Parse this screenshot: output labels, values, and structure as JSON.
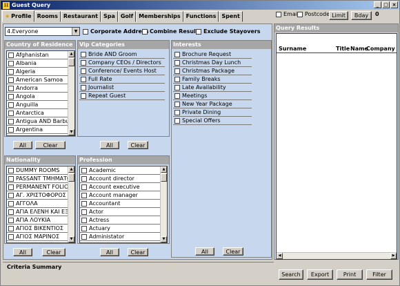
{
  "window": {
    "title": "Guest Query",
    "icon_letter": "H"
  },
  "tabs": [
    "Profile",
    "Rooms",
    "Restaurant",
    "Spa",
    "Golf",
    "Memberships",
    "Functions",
    "Spent"
  ],
  "topright": {
    "email_label": "Email",
    "postcode_label": "Postcode",
    "limit_label": "Limit",
    "bday_label": "Bday",
    "count": "0"
  },
  "filters": {
    "dropdown_value": "4.Everyone",
    "corporate_label": "Corporate Address",
    "combine_label": "Combine Results",
    "exclude_label": "Exclude Stayovers"
  },
  "country": {
    "title": "Country of Residence",
    "items": [
      "Afghanistan",
      "Albania",
      "Algeria",
      "American Samoa",
      "Andorra",
      "Angola",
      "Anguilla",
      "Antarctica",
      "Antigua AND Barbuda",
      "Argentina"
    ]
  },
  "vip": {
    "title": "Vip Categories",
    "items": [
      "Bride AND Groom",
      "Company CEOs / Directors",
      "Conference/ Events Host",
      "Full Rate",
      "Journalist",
      "Repeat Guest"
    ]
  },
  "interests": {
    "title": "Interests",
    "items": [
      "Brochure Request",
      "Christmas Day Lunch",
      "Christmas Package",
      "Family Breaks",
      "Late Availability",
      "Meetings",
      "New Year Package",
      "Private Dining",
      "Special Offers"
    ]
  },
  "nationality": {
    "title": "Nationality",
    "items": [
      "DUMMY ROOMS",
      "PASSANT ΤΜΗΜΑΤΩΝ",
      "PERMANENT FOLIO",
      "ΑΓ. ΧΡΙΣΤΟΦΟΡΟΣ ΚΑΙ",
      "ΑΓΓΟΛΑ",
      "ΑΓΙΑ ΕΛΕΝΗ ΚΑΙ ΕΞΑΡΤ",
      "ΑΓΙΑ ΛΟΥΚΙΑ",
      "ΑΓΙΟΣ ΒΙΚΕΝΤΙΟΣ",
      "ΑΓΙΟΣ ΜΑΡΙΝΟΣ"
    ]
  },
  "profession": {
    "title": "Profession",
    "items": [
      "Academic",
      "Account director",
      "Account executive",
      "Account manager",
      "Accountant",
      "Actor",
      "Actress",
      "Actuary",
      "Administator"
    ]
  },
  "buttons": {
    "all": "All",
    "clear": "Clear"
  },
  "query_results": {
    "title": "Query Results",
    "columns": [
      "Surname",
      "Title",
      "Name",
      "Company"
    ]
  },
  "criteria": {
    "label": "Criteria Summary"
  },
  "actions": {
    "search": "Search",
    "export": "Export",
    "print": "Print",
    "filter": "Filter"
  }
}
